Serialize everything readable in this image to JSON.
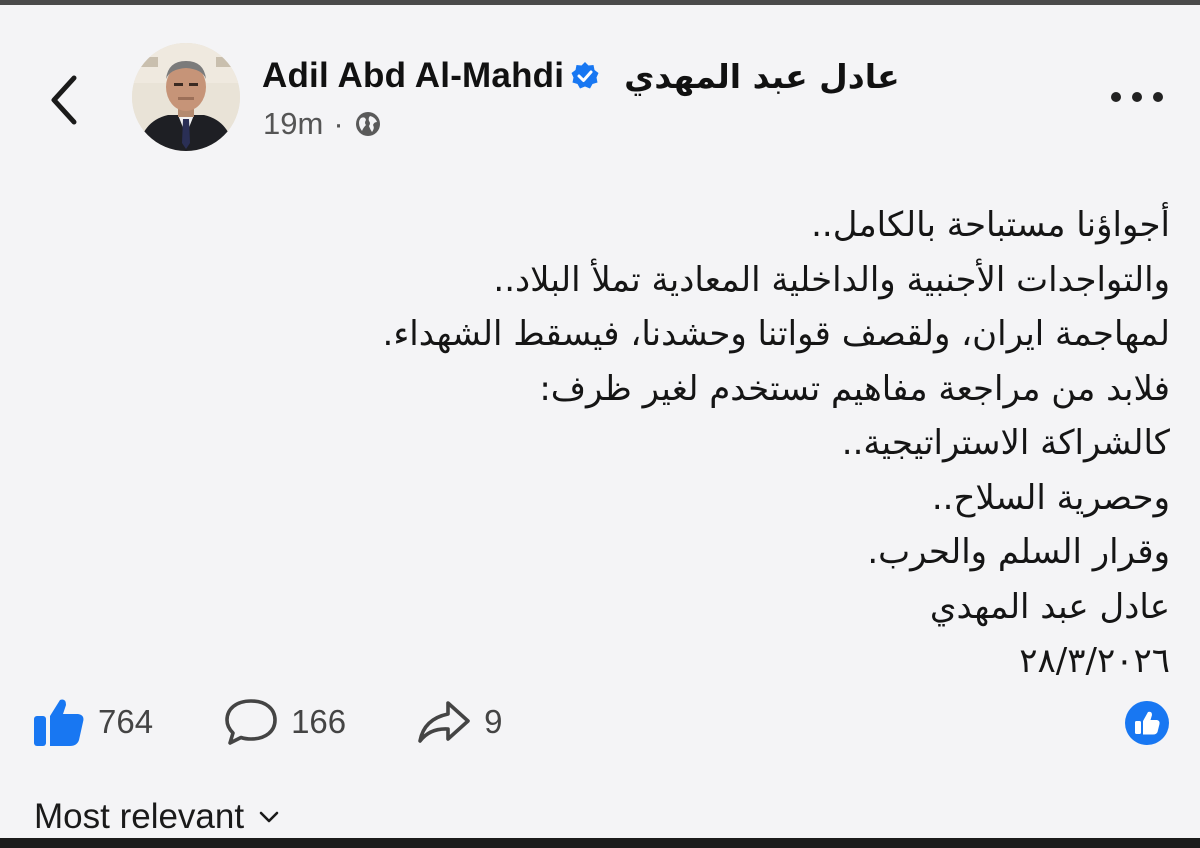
{
  "post": {
    "author_en": "Adil Abd Al-Mahdi",
    "author_ar": "عادل عبد المهدي",
    "time": "19m",
    "separator": "·",
    "lines": [
      "أجواؤنا مستباحة بالكامل..",
      "والتواجدات الأجنبية والداخلية المعادية تملأ البلاد..",
      "لمهاجمة ايران، ولقصف قواتنا وحشدنا، فيسقط الشهداء.",
      "فلابد من مراجعة مفاهيم تستخدم لغير ظرف:",
      "كالشراكة الاستراتيجية..",
      "وحصرية السلاح..",
      "وقرار السلم والحرب.",
      "عادل عبد المهدي",
      "٢٨/٣/٢٠٢٦"
    ]
  },
  "stats": {
    "likes": "764",
    "comments": "166",
    "shares": "9"
  },
  "sort": {
    "label": "Most relevant"
  },
  "colors": {
    "accent": "#1877f2",
    "background": "#f4f4f6",
    "text": "#111111",
    "secondary": "#555555"
  },
  "icons": [
    "back-icon",
    "verified-badge-icon",
    "globe-icon",
    "more-icon",
    "like-icon",
    "comment-icon",
    "share-icon",
    "like-reaction-icon",
    "chevron-down-icon"
  ]
}
